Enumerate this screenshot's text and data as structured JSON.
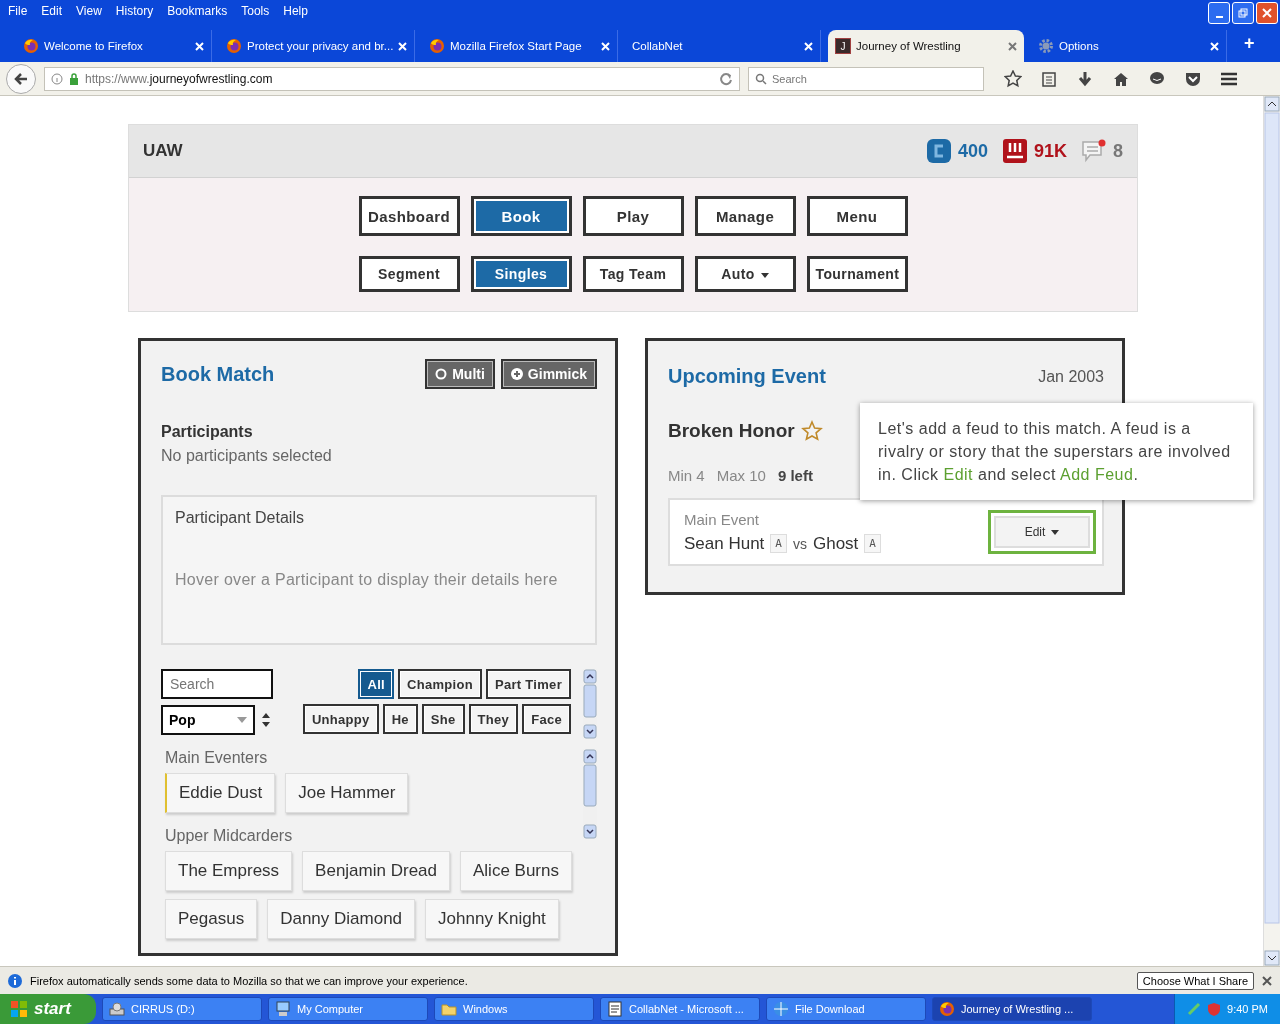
{
  "menu": [
    "File",
    "Edit",
    "View",
    "History",
    "Bookmarks",
    "Tools",
    "Help"
  ],
  "tabs": [
    {
      "title": "Welcome to Firefox",
      "kind": "firefox",
      "selected": false
    },
    {
      "title": "Protect your privacy and br...",
      "kind": "firefox",
      "selected": false
    },
    {
      "title": "Mozilla Firefox Start Page",
      "kind": "firefox",
      "selected": false
    },
    {
      "title": "CollabNet",
      "kind": "plain",
      "selected": false
    },
    {
      "title": "Journey of Wrestling",
      "kind": "letter",
      "selected": true
    },
    {
      "title": "Options",
      "kind": "gear",
      "selected": false
    }
  ],
  "tab_favicon_letter": "J",
  "new_tab": "+",
  "address_bar": {
    "url_prefix": "https://www.",
    "url_domain": "journeyofwrestling.com"
  },
  "search": {
    "placeholder": "Search"
  },
  "header": {
    "title": "UAW",
    "stats": [
      {
        "kind": "coin",
        "value": "400",
        "color": "#1d6aa6"
      },
      {
        "kind": "cash",
        "value": "91K",
        "color": "#b0121b"
      },
      {
        "kind": "messages",
        "value": "8",
        "color": "#777777"
      }
    ]
  },
  "nav": [
    {
      "label": "Dashboard",
      "selected": false
    },
    {
      "label": "Book",
      "selected": true
    },
    {
      "label": "Play",
      "selected": false
    },
    {
      "label": "Manage",
      "selected": false
    },
    {
      "label": "Menu",
      "selected": false
    }
  ],
  "subnav": [
    {
      "label": "Segment",
      "selected": false,
      "dropdown": false
    },
    {
      "label": "Singles",
      "selected": true,
      "dropdown": false
    },
    {
      "label": "Tag Team",
      "selected": false,
      "dropdown": false
    },
    {
      "label": "Auto",
      "selected": false,
      "dropdown": true
    },
    {
      "label": "Tournament",
      "selected": false,
      "dropdown": false
    }
  ],
  "book_match": {
    "title": "Book Match",
    "toggles": [
      {
        "label": "Multi",
        "kind": "radio"
      },
      {
        "label": "Gimmick",
        "kind": "plus"
      }
    ],
    "participants_label": "Participants",
    "participants_status": "No participants selected",
    "details": {
      "title": "Participant Details",
      "hint": "Hover over a Participant to display their details here"
    },
    "search": {
      "placeholder": "Search"
    },
    "sort": {
      "value": "Pop"
    },
    "filters": [
      {
        "label": "All",
        "selected": true
      },
      {
        "label": "Champion",
        "selected": false
      },
      {
        "label": "Part Timer",
        "selected": false
      },
      {
        "label": "Unhappy",
        "selected": false
      },
      {
        "label": "He",
        "selected": false
      },
      {
        "label": "She",
        "selected": false
      },
      {
        "label": "They",
        "selected": false
      },
      {
        "label": "Face",
        "selected": false
      }
    ],
    "groups": [
      {
        "title": "Main Eventers",
        "members": [
          {
            "name": "Eddie Dust",
            "highlighted": true
          },
          {
            "name": "Joe Hammer",
            "highlighted": false
          }
        ]
      },
      {
        "title": "Upper Midcarders",
        "members": [
          {
            "name": "The Empress",
            "highlighted": false
          },
          {
            "name": "Benjamin Dread",
            "highlighted": false
          },
          {
            "name": "Alice Burns",
            "highlighted": false
          },
          {
            "name": "Pegasus",
            "highlighted": false
          },
          {
            "name": "Danny Diamond",
            "highlighted": false
          },
          {
            "name": "Johnny Knight",
            "highlighted": false
          }
        ]
      }
    ]
  },
  "upcoming": {
    "title": "Upcoming Event",
    "date": "Jan 2003",
    "event": "Broken Honor",
    "starred": false,
    "min": "Min 4",
    "max": "Max 10",
    "left": "9 left",
    "match": {
      "label": "Main Event",
      "p1": "Sean Hunt",
      "b1": "A",
      "vs": "vs",
      "p2": "Ghost",
      "b2": "A",
      "button": "Edit",
      "highlighted": true
    }
  },
  "tooltip": {
    "text": "Let's add a feud to this match. A feud is a rivalry or story that the superstars are involved in. Click **Edit** and select **Add Feud**."
  },
  "notification": {
    "text": "Firefox automatically sends some data to Mozilla so that we can improve your experience.",
    "button": "Choose What I Share"
  },
  "taskbar": {
    "start": "start",
    "items": [
      {
        "label": "CIRRUS (D:)",
        "kind": "drive",
        "selected": false
      },
      {
        "label": "My Computer",
        "kind": "computer",
        "selected": false
      },
      {
        "label": "Windows",
        "kind": "folder",
        "selected": false
      },
      {
        "label": "CollabNet - Microsoft ...",
        "kind": "document",
        "selected": false
      },
      {
        "label": "File Download",
        "kind": "globe",
        "selected": false
      },
      {
        "label": "Journey of Wrestling ...",
        "kind": "firefox",
        "selected": true
      }
    ],
    "clock": "9:40 PM"
  }
}
